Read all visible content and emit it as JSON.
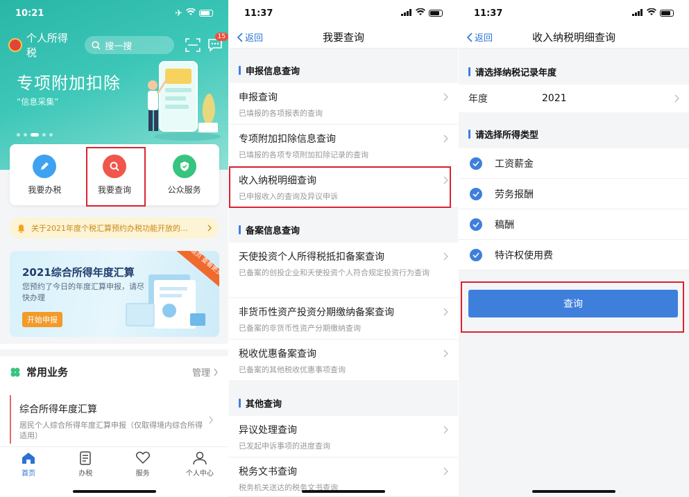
{
  "screen1": {
    "status_time": "10:21",
    "app_name": "个人所得税",
    "search_placeholder": "搜一搜",
    "message_badge": "15",
    "hero_title": "专项附加扣除",
    "hero_subtitle": "“信息采集”",
    "actions": [
      {
        "label": "我要办税",
        "icon": "pen-icon",
        "color": "#3ea2f0"
      },
      {
        "label": "我要查询",
        "icon": "magnifier-icon",
        "color": "#f0564a"
      },
      {
        "label": "公众服务",
        "icon": "shield-icon",
        "color": "#36c47f"
      }
    ],
    "notice": "关于2021年度个税汇算预约办税功能开放的...",
    "banner": {
      "title": "2021综合所得年度汇算",
      "desc": "您预约了今日的年度汇算申报，请尽快办理",
      "button": "开始申报",
      "corner": "进入专题页 查看更多操作"
    },
    "common": {
      "title": "常用业务",
      "manage": "管理",
      "item_title": "综合所得年度汇算",
      "item_desc": "居民个人综合所得年度汇算申报（仅取得境内综合所得适用）"
    },
    "tabs": [
      {
        "label": "首页",
        "icon": "home-icon"
      },
      {
        "label": "办税",
        "icon": "document-icon"
      },
      {
        "label": "服务",
        "icon": "heart-hands-icon"
      },
      {
        "label": "个人中心",
        "icon": "person-icon"
      }
    ]
  },
  "screen2": {
    "status_time": "11:37",
    "back": "返回",
    "title": "我要查询",
    "sections": [
      {
        "title": "申报信息查询",
        "items": [
          {
            "title": "申报查询",
            "desc": "已填报的各项报表的查询"
          },
          {
            "title": "专项附加扣除信息查询",
            "desc": "已填报的各项专项附加扣除记录的查询"
          },
          {
            "title": "收入纳税明细查询",
            "desc": "已申报收入的查询及异议申诉"
          }
        ]
      },
      {
        "title": "备案信息查询",
        "items": [
          {
            "title": "天使投资个人所得税抵扣备案查询",
            "desc": "已备案的创投企业和天使投资个人符合规定投资行为查询"
          },
          {
            "title": "非货币性资产投资分期缴纳备案查询",
            "desc": "已备案的非货币性资产分期缴纳查询"
          },
          {
            "title": "税收优惠备案查询",
            "desc": "已备案的其他税收优惠事项查询"
          }
        ]
      },
      {
        "title": "其他查询",
        "items": [
          {
            "title": "异议处理查询",
            "desc": "已发起申诉事项的进度查询"
          },
          {
            "title": "税务文书查询",
            "desc": "税务机关送达的税务文书查询"
          }
        ]
      }
    ]
  },
  "screen3": {
    "status_time": "11:37",
    "back": "返回",
    "title": "收入纳税明细查询",
    "year_section": "请选择纳税记录年度",
    "year_label": "年度",
    "year_value": "2021",
    "type_section": "请选择所得类型",
    "types": [
      "工资薪金",
      "劳务报酬",
      "稿酬",
      "特许权使用费"
    ],
    "query_button": "查询"
  },
  "colors": {
    "accent_blue": "#3f7fdc",
    "highlight_red": "#d9232e",
    "hero_teal": "#2ab6a6"
  }
}
